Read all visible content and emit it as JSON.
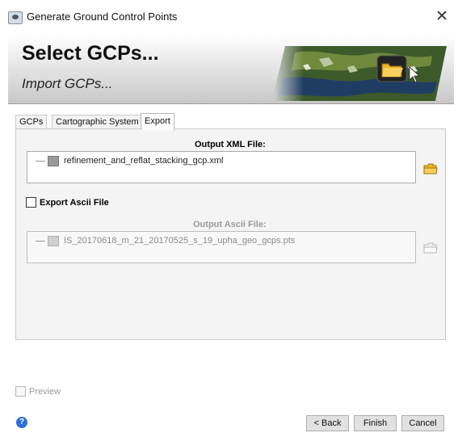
{
  "window": {
    "title": "Generate Ground Control Points"
  },
  "banner": {
    "title": "Select GCPs...",
    "subtitle": "Import GCPs..."
  },
  "tabs": [
    {
      "label": "GCPs",
      "active": false
    },
    {
      "label": "Cartographic System",
      "active": false
    },
    {
      "label": "Export",
      "active": true
    }
  ],
  "export": {
    "output_xml_label": "Output XML File:",
    "output_xml_file": "refinement_and_reflat_stacking_gcp.xml",
    "export_ascii_label": "Export Ascii File",
    "export_ascii_checked": false,
    "output_ascii_label": "Output Ascii File:",
    "output_ascii_file": "IS_20170618_m_21_20170525_s_19_upha_geo_gcps.pts"
  },
  "footer": {
    "preview_label": "Preview",
    "preview_checked": false,
    "back_label": "< Back",
    "finish_label": "Finish",
    "cancel_label": "Cancel",
    "help_symbol": "?"
  },
  "icons": {
    "app": "app-icon",
    "close": "close-icon",
    "file": "file-icon",
    "folder": "folder-open-icon",
    "help": "help-icon"
  },
  "colors": {
    "folder_active": "#f0b429",
    "help_blue": "#2e6ed6"
  }
}
